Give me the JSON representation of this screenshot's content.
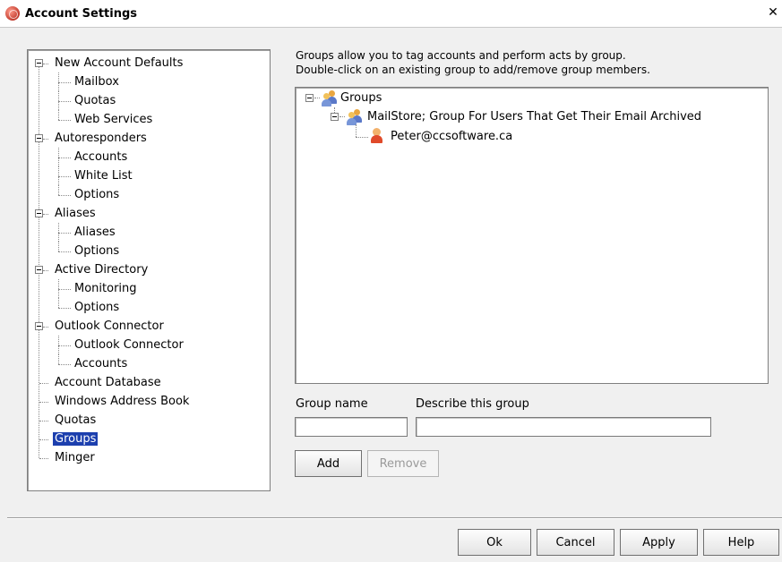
{
  "window": {
    "title": "Account Settings",
    "close_glyph": "✕"
  },
  "tree": {
    "items": [
      {
        "label": "New Account Defaults",
        "level": 0,
        "expanded": true
      },
      {
        "label": "Mailbox",
        "level": 1
      },
      {
        "label": "Quotas",
        "level": 1
      },
      {
        "label": "Web Services",
        "level": 1
      },
      {
        "label": "Autoresponders",
        "level": 0,
        "expanded": true
      },
      {
        "label": "Accounts",
        "level": 1
      },
      {
        "label": "White List",
        "level": 1
      },
      {
        "label": "Options",
        "level": 1
      },
      {
        "label": "Aliases",
        "level": 0,
        "expanded": true
      },
      {
        "label": "Aliases",
        "level": 1
      },
      {
        "label": "Options",
        "level": 1
      },
      {
        "label": "Active Directory",
        "level": 0,
        "expanded": true
      },
      {
        "label": "Monitoring",
        "level": 1
      },
      {
        "label": "Options",
        "level": 1
      },
      {
        "label": "Outlook Connector",
        "level": 0,
        "expanded": true
      },
      {
        "label": "Outlook Connector",
        "level": 1
      },
      {
        "label": "Accounts",
        "level": 1
      },
      {
        "label": "Account Database",
        "level": 0
      },
      {
        "label": "Windows Address Book",
        "level": 0
      },
      {
        "label": "Quotas",
        "level": 0
      },
      {
        "label": "Groups",
        "level": 0,
        "selected": true
      },
      {
        "label": "Minger",
        "level": 0
      }
    ]
  },
  "description": {
    "line1": "Groups allow you to tag accounts and perform acts by group.",
    "line2": "Double-click on an existing group to add/remove group members."
  },
  "groups_tree": {
    "root": "Groups",
    "group": "MailStore; Group For Users That Get Their Email Archived",
    "member": "Peter@ccsoftware.ca"
  },
  "form": {
    "group_name_label": "Group name",
    "describe_label": "Describe this group",
    "group_name_value": "",
    "describe_value": "",
    "add_label": "Add",
    "remove_label": "Remove"
  },
  "footer": {
    "ok_label": "Ok",
    "cancel_label": "Cancel",
    "apply_label": "Apply",
    "help_label": "Help"
  },
  "colors": {
    "selection": "#1c3fae",
    "background": "#f0f0f0"
  },
  "icons": {
    "app": "mdaemon-app-icon",
    "group": "group-people-icon",
    "user": "user-person-icon"
  }
}
